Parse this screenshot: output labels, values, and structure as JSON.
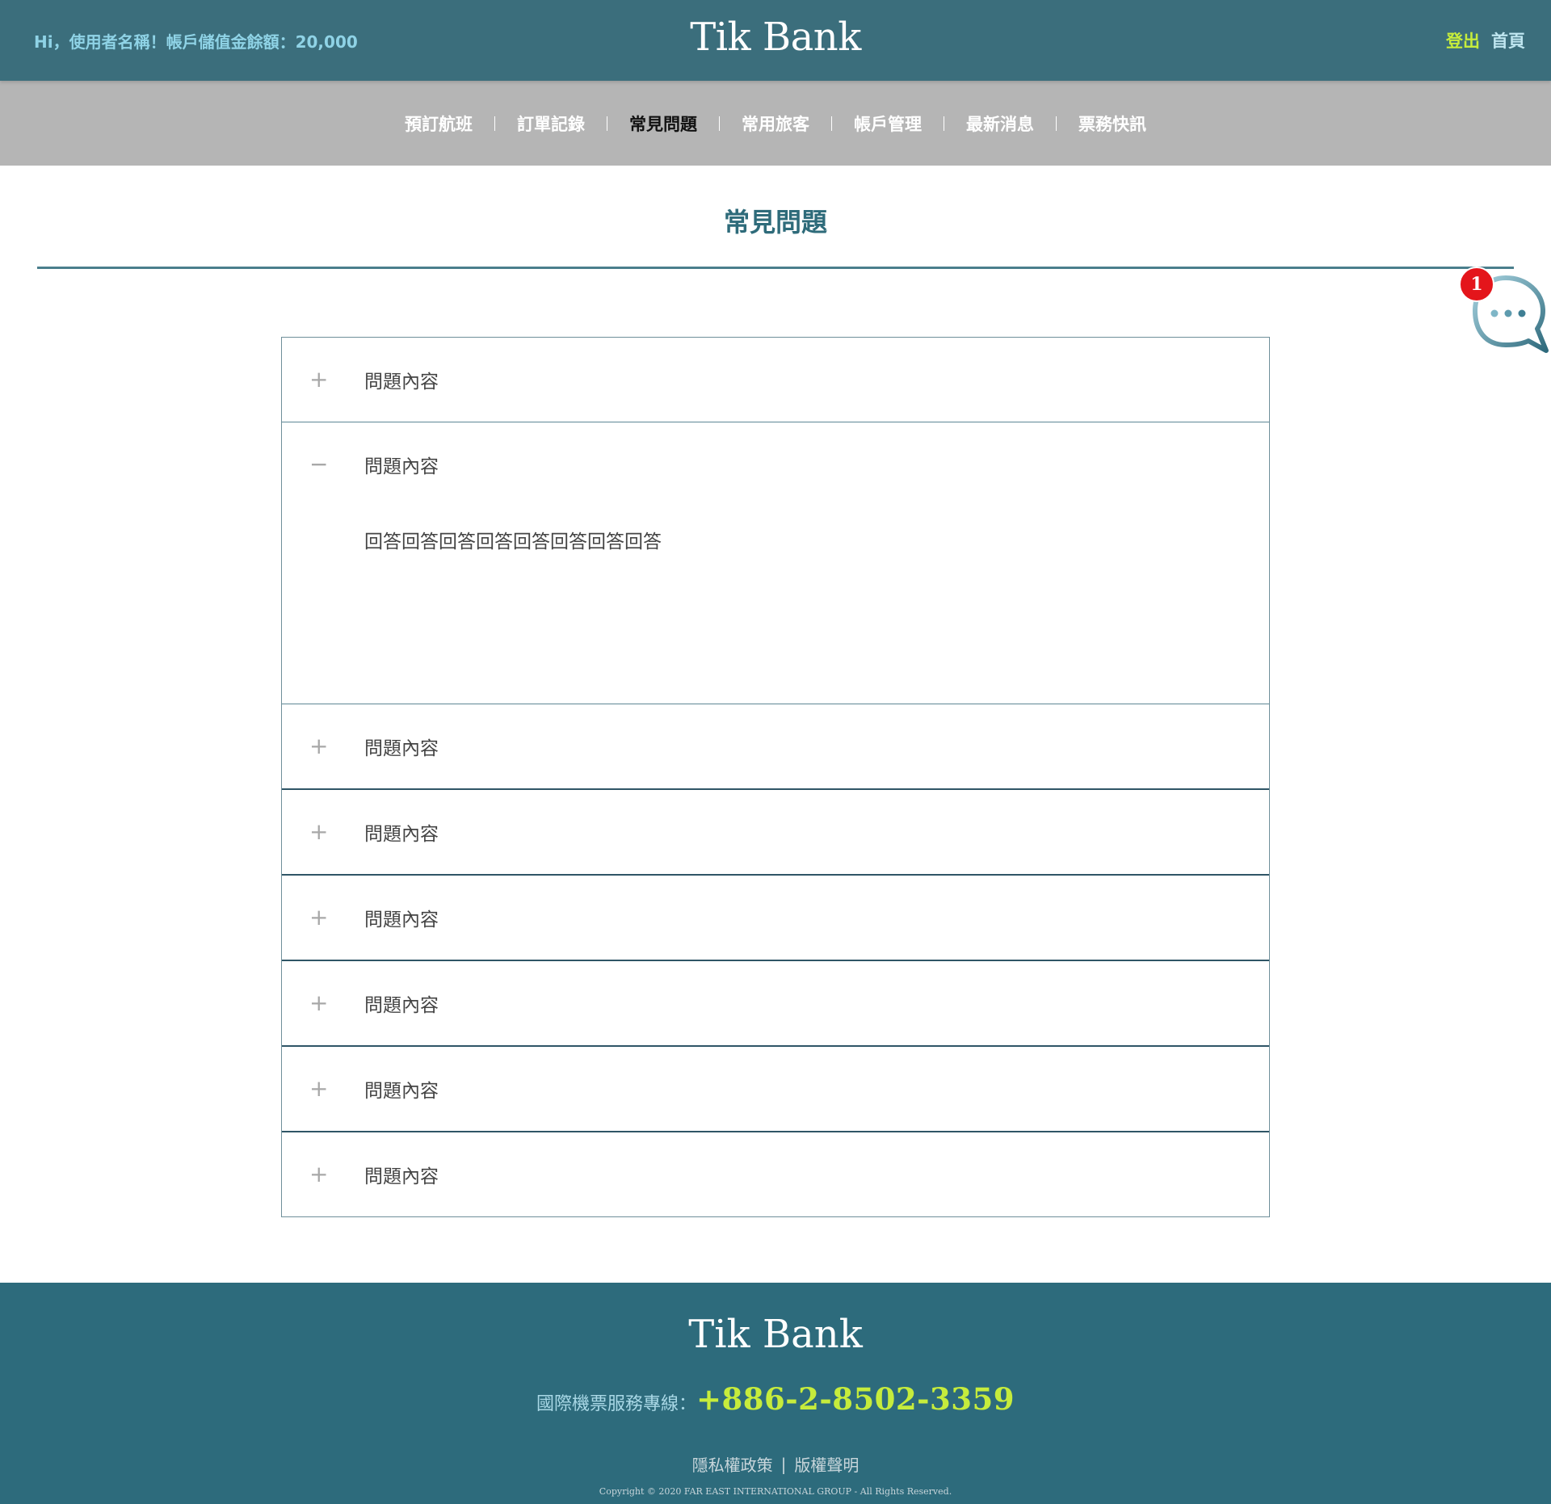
{
  "header": {
    "greeting": "Hi，使用者名稱！帳戶儲值金餘額：20,000",
    "brand": "Tik Bank",
    "logout_label": "登出",
    "home_label": "首頁"
  },
  "nav": {
    "items": [
      {
        "label": "預訂航班"
      },
      {
        "label": "訂單記錄"
      },
      {
        "label": "常見問題"
      },
      {
        "label": "常用旅客"
      },
      {
        "label": "帳戶管理"
      },
      {
        "label": "最新消息"
      },
      {
        "label": "票務快訊"
      }
    ],
    "active_index": 2
  },
  "page": {
    "title": "常見問題"
  },
  "chat": {
    "badge_count": "1",
    "icon": "chat-bubble-icon"
  },
  "faq": {
    "items": [
      {
        "question": "問題內容",
        "toggle": "+",
        "expanded": false
      },
      {
        "question": "問題內容",
        "toggle": "−",
        "expanded": true,
        "answer": "回答回答回答回答回答回答回答回答"
      },
      {
        "question": "問題內容",
        "toggle": "+",
        "expanded": false
      },
      {
        "question": "問題內容",
        "toggle": "+",
        "expanded": false
      },
      {
        "question": "問題內容",
        "toggle": "+",
        "expanded": false
      },
      {
        "question": "問題內容",
        "toggle": "+",
        "expanded": false
      },
      {
        "question": "問題內容",
        "toggle": "+",
        "expanded": false
      },
      {
        "question": "問題內容",
        "toggle": "+",
        "expanded": false
      }
    ]
  },
  "footer": {
    "brand": "Tik Bank",
    "hotline_label": "國際機票服務專線：",
    "hotline_number": "+886-2-8502-3359",
    "privacy_label": "隱私權政策",
    "separator": "|",
    "copyright_label": "版權聲明",
    "copyright_text": "Copyright © 2020 FAR EAST INTERNATIONAL GROUP - All Rights Reserved."
  },
  "colors": {
    "header_bg": "#3b6e7c",
    "nav_bg": "#b5b5b5",
    "accent_green": "#c6ec3c",
    "title_teal": "#2e6b7a",
    "footer_bg": "#2d6b7c",
    "badge_red": "#e4151b"
  }
}
